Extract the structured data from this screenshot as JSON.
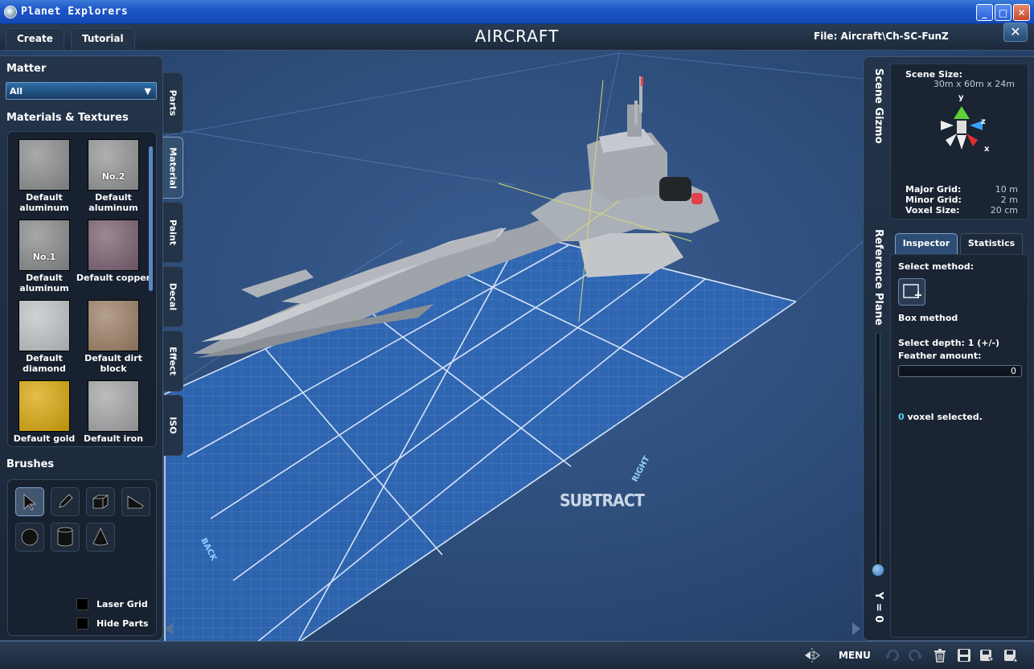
{
  "window": {
    "title": "Planet Explorers",
    "minimize": "_",
    "maximize": "□",
    "close": "✕"
  },
  "topbar": {
    "tabs": [
      {
        "label": "Create"
      },
      {
        "label": "Tutorial"
      }
    ],
    "app_title": "AIRCRAFT",
    "file_info": "File:  Aircraft\\Ch-SC-FunZ",
    "close_label": "✕"
  },
  "left": {
    "matter_title": "Matter",
    "matter_value": "All",
    "materials_title": "Materials & Textures",
    "materials": [
      {
        "number": "",
        "name": "Default aluminum",
        "color": "#8c8e8f"
      },
      {
        "number": "No.2",
        "name": "Default aluminum",
        "color": "#939596"
      },
      {
        "number": "No.1",
        "name": "Default aluminum",
        "color": "#8a8b8c"
      },
      {
        "number": "",
        "name": "Default copper",
        "color": "#7a6070"
      },
      {
        "number": "",
        "name": "Default diamond",
        "color": "#bfc4c6"
      },
      {
        "number": "",
        "name": "Default dirt block",
        "color": "#9c8065"
      },
      {
        "number": "",
        "name": "Default gold",
        "color": "#d9a80c"
      },
      {
        "number": "",
        "name": "Default iron",
        "color": "#a4a6a8"
      }
    ],
    "brushes_title": "Brushes",
    "brushes": [
      "select-icon",
      "pencil-icon",
      "cube-icon",
      "wedge-icon",
      "sphere-icon",
      "cylinder-icon",
      "cone-icon"
    ],
    "laser_grid": "Laser Grid",
    "hide_parts": "Hide Parts"
  },
  "vtabs": [
    {
      "label": "Parts",
      "active": false
    },
    {
      "label": "Material",
      "active": true
    },
    {
      "label": "Paint",
      "active": false
    },
    {
      "label": "Decal",
      "active": false
    },
    {
      "label": "Effect",
      "active": false
    },
    {
      "label": "ISO",
      "active": false
    }
  ],
  "viewport": {
    "mode_text": "SUBTRACT",
    "grid_back": "BACK",
    "grid_right": "RIGHT"
  },
  "right": {
    "scene_gizmo_title": "Scene Gizmo",
    "scene_size_label": "Scene Size:",
    "scene_size_value": "30m x 60m x 24m",
    "axis_x": "x",
    "axis_y": "y",
    "axis_z": "z",
    "major_grid_label": "Major Grid:",
    "major_grid_value": "10 m",
    "minor_grid_label": "Minor Grid:",
    "minor_grid_value": "2 m",
    "voxel_size_label": "Voxel Size:",
    "voxel_size_value": "20 cm",
    "reference_plane_title": "Reference Plane",
    "y_label": "Y = 0",
    "tabs": [
      {
        "label": "Inspector",
        "active": true
      },
      {
        "label": "Statistics",
        "active": false
      }
    ],
    "select_method_label": "Select method:",
    "box_method_label": "Box method",
    "select_depth_label": "Select depth: 1 (+/-)",
    "feather_label": "Feather amount:",
    "feather_value": "0",
    "voxel_count": "0",
    "voxel_selected_label": "voxel selected."
  },
  "bottom": {
    "menu_label": "MENU"
  },
  "colors": {
    "accent": "#2e6bd0",
    "panel": "#1d2a3c",
    "grid": "#3f7bd0",
    "voxel_count": "#4fd1ff"
  }
}
